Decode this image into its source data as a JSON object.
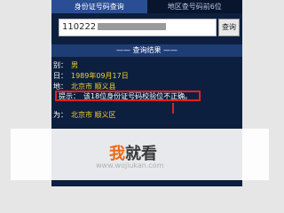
{
  "tabs": [
    "身份证号码查询",
    "地区查号码前6位"
  ],
  "search": {
    "value_visible": "110222",
    "button_label": "查询"
  },
  "result": {
    "header": "查询结果",
    "rows": [
      {
        "label": "别：",
        "value": "男"
      },
      {
        "label": "日：",
        "value": "1989年09月17日"
      },
      {
        "label": "地：",
        "value": "北京市 顺义县"
      },
      {
        "label": "提示：",
        "value": "该18位身份证号码校验位不正确。"
      },
      {
        "label": "为：",
        "value": "北京市 顺义区"
      }
    ]
  },
  "watermark": {
    "brand_accent": "我",
    "brand_rest": "就看",
    "url": "www.wojiukan.com"
  },
  "colors": {
    "accent": "#ec6a13",
    "highlight": "#e02020",
    "value_text": "#f2d02b"
  }
}
